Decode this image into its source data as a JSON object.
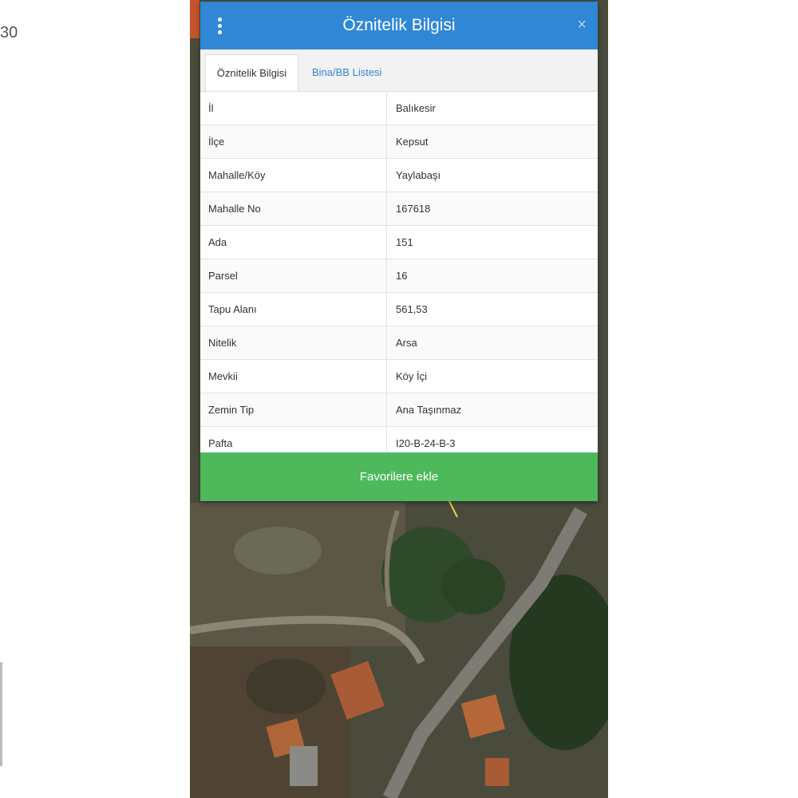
{
  "background": {
    "corner_text": "30"
  },
  "dialog": {
    "title": "Öznitelik Bilgisi",
    "close_label": "×",
    "tabs": [
      {
        "label": "Öznitelik Bilgisi",
        "active": true
      },
      {
        "label": "Bina/BB Listesi",
        "active": false
      }
    ],
    "rows": [
      {
        "key": "İl",
        "value": "Balıkesir"
      },
      {
        "key": "İlçe",
        "value": "Kepsut"
      },
      {
        "key": "Mahalle/Köy",
        "value": "Yaylabaşı"
      },
      {
        "key": "Mahalle No",
        "value": "167618"
      },
      {
        "key": "Ada",
        "value": "151"
      },
      {
        "key": "Parsel",
        "value": "16"
      },
      {
        "key": "Tapu Alanı",
        "value": "561,53"
      },
      {
        "key": "Nitelik",
        "value": "Arsa"
      },
      {
        "key": "Mevkii",
        "value": "Köy İçi"
      },
      {
        "key": "Zemin Tip",
        "value": "Ana Taşınmaz"
      },
      {
        "key": "Pafta",
        "value": "I20-B-24-B-3"
      }
    ],
    "favorite_button": "Favorilere ekle"
  },
  "colors": {
    "header": "#2f87d6",
    "button": "#4db95b",
    "tab_link": "#2f87d6",
    "map_strip": "#c4532b"
  },
  "icons": {
    "menu": "kebab-menu-icon",
    "close": "close-icon"
  }
}
